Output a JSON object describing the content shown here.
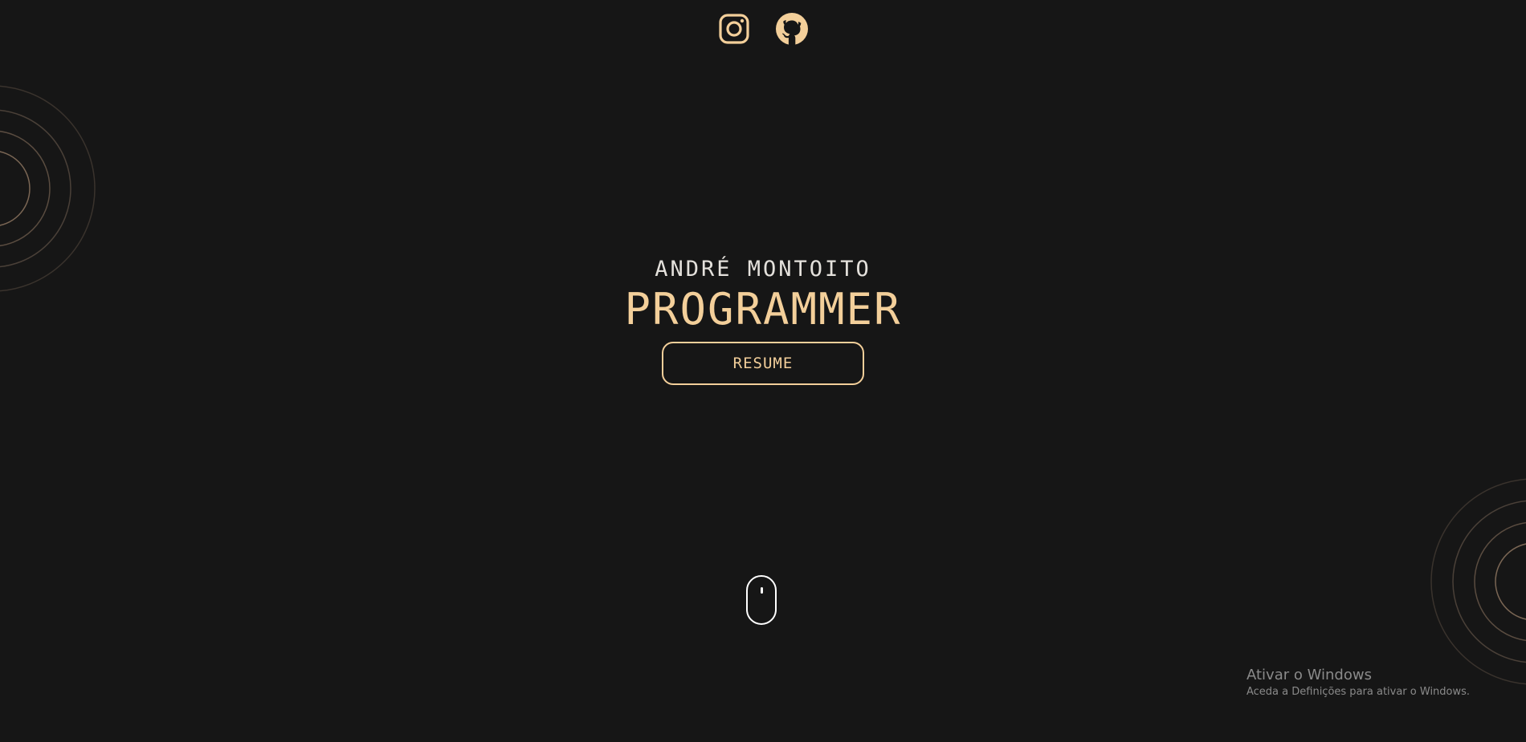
{
  "header": {
    "socials": [
      {
        "icon": "instagram-icon",
        "label": "Instagram"
      },
      {
        "icon": "github-icon",
        "label": "GitHub"
      }
    ]
  },
  "hero": {
    "name": "ANDRÉ MONTOITO",
    "role": "PROGRAMMER",
    "resume_label": "RESUME"
  },
  "scroll_indicator": {
    "icon": "mouse-scroll-icon"
  },
  "windows_watermark": {
    "title": "Ativar o Windows",
    "subtitle": "Aceda a Definições para ativar o Windows."
  },
  "colors": {
    "background": "#161616",
    "accent": "#f3cf9a",
    "name_text": "#e4e1dc",
    "ring": "#6b5a4a"
  }
}
